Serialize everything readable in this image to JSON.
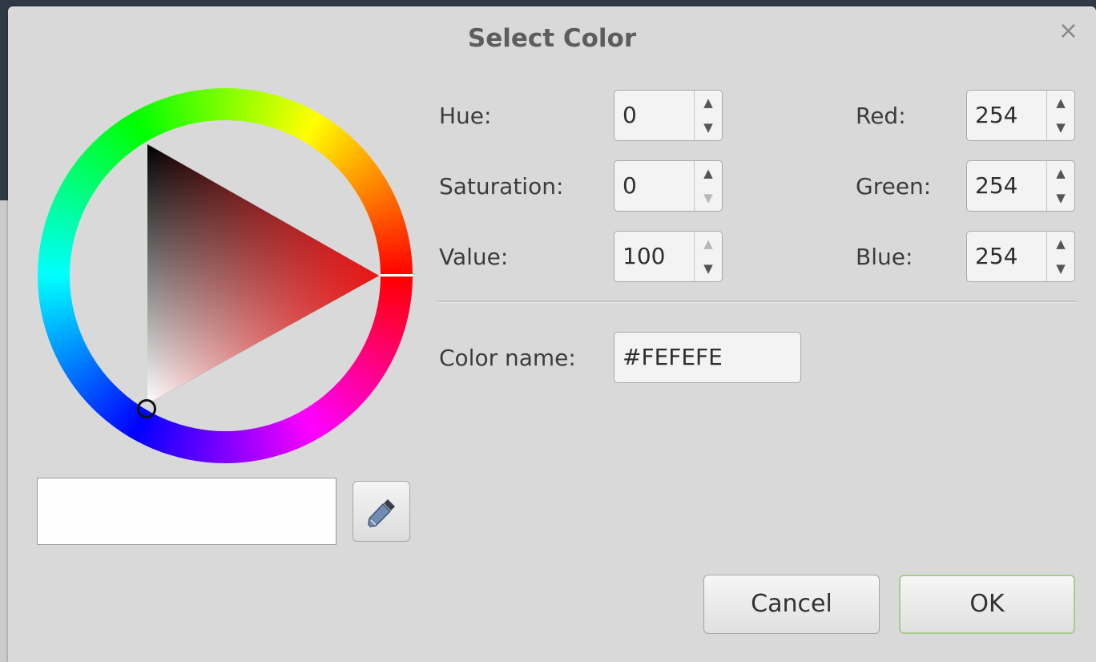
{
  "dialog": {
    "title": "Select Color",
    "close_glyph": "×"
  },
  "color": {
    "hue_rgb_hex": "#ff0000",
    "preview_hex": "#FEFEFE"
  },
  "fields": {
    "hue_label": "Hue:",
    "hue_value": "0",
    "saturation_label": "Saturation:",
    "saturation_value": "0",
    "value_label": "Value:",
    "value_value": "100",
    "red_label": "Red:",
    "red_value": "254",
    "green_label": "Green:",
    "green_value": "254",
    "blue_label": "Blue:",
    "blue_value": "254",
    "color_name_label": "Color name:",
    "color_name_value": "#FEFEFE"
  },
  "icons": {
    "spin_up": "▲",
    "spin_down": "▼",
    "eyedropper": "eyedropper-icon",
    "close": "close-icon"
  },
  "buttons": {
    "cancel": "Cancel",
    "ok": "OK"
  }
}
